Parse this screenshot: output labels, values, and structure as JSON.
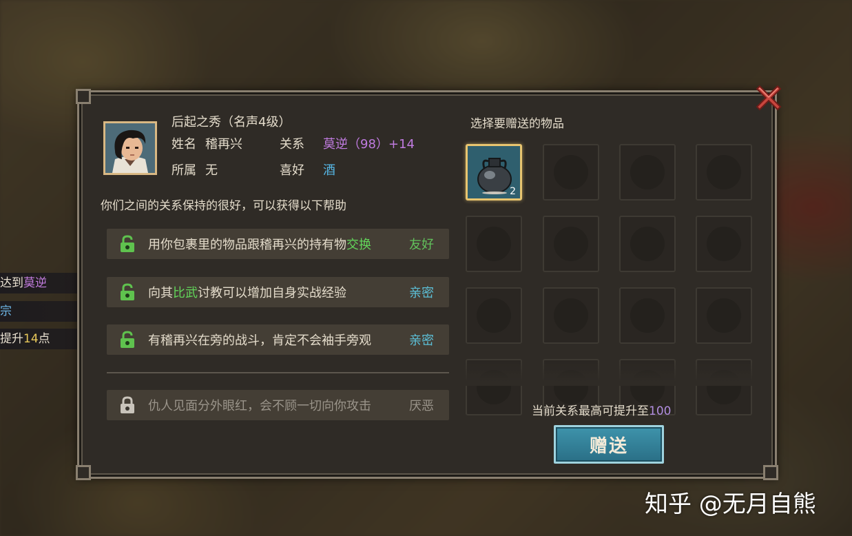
{
  "side_notices": [
    {
      "text_before": "达到",
      "highlight": "莫逆",
      "text_after": ""
    },
    {
      "text_before": "",
      "highlight": "宗",
      "text_after": ""
    },
    {
      "text_before": "提升",
      "number": "14",
      "text_after": "点"
    }
  ],
  "character": {
    "title": "后起之秀（名声4级）",
    "name_label": "姓名",
    "name": "稽再兴",
    "faction_label": "所属",
    "faction": "无",
    "relation_label": "关系",
    "relation": "莫逆（98）+14",
    "hobby_label": "喜好",
    "hobby": "酒"
  },
  "relation_summary": "你们之间的关系保持的很好，可以获得以下帮助",
  "help_rows": [
    {
      "before": "用你包裹里的物品跟稽再兴的持有物",
      "green": "交换",
      "after": "",
      "tag": "友好",
      "locked": false
    },
    {
      "before": "向其",
      "green": "比武",
      "after": "讨教可以增加自身实战经验",
      "tag": "亲密",
      "locked": false
    },
    {
      "before": "有稽再兴在旁的战斗，肯定不会袖手旁观",
      "green": "",
      "after": "",
      "tag": "亲密",
      "locked": false
    },
    {
      "before": "仇人见面分外眼红，会不顾一切向你攻击",
      "green": "",
      "after": "",
      "tag": "厌恶",
      "locked": true
    }
  ],
  "gift_panel": {
    "title": "选择要赠送的物品",
    "selected_item": {
      "icon": "wine-jar-icon",
      "count": "2"
    },
    "max_note_prefix": "当前关系最高可提升至",
    "max_value": "100",
    "gift_button": "赠送"
  },
  "watermark": "知乎 @无月自熊"
}
